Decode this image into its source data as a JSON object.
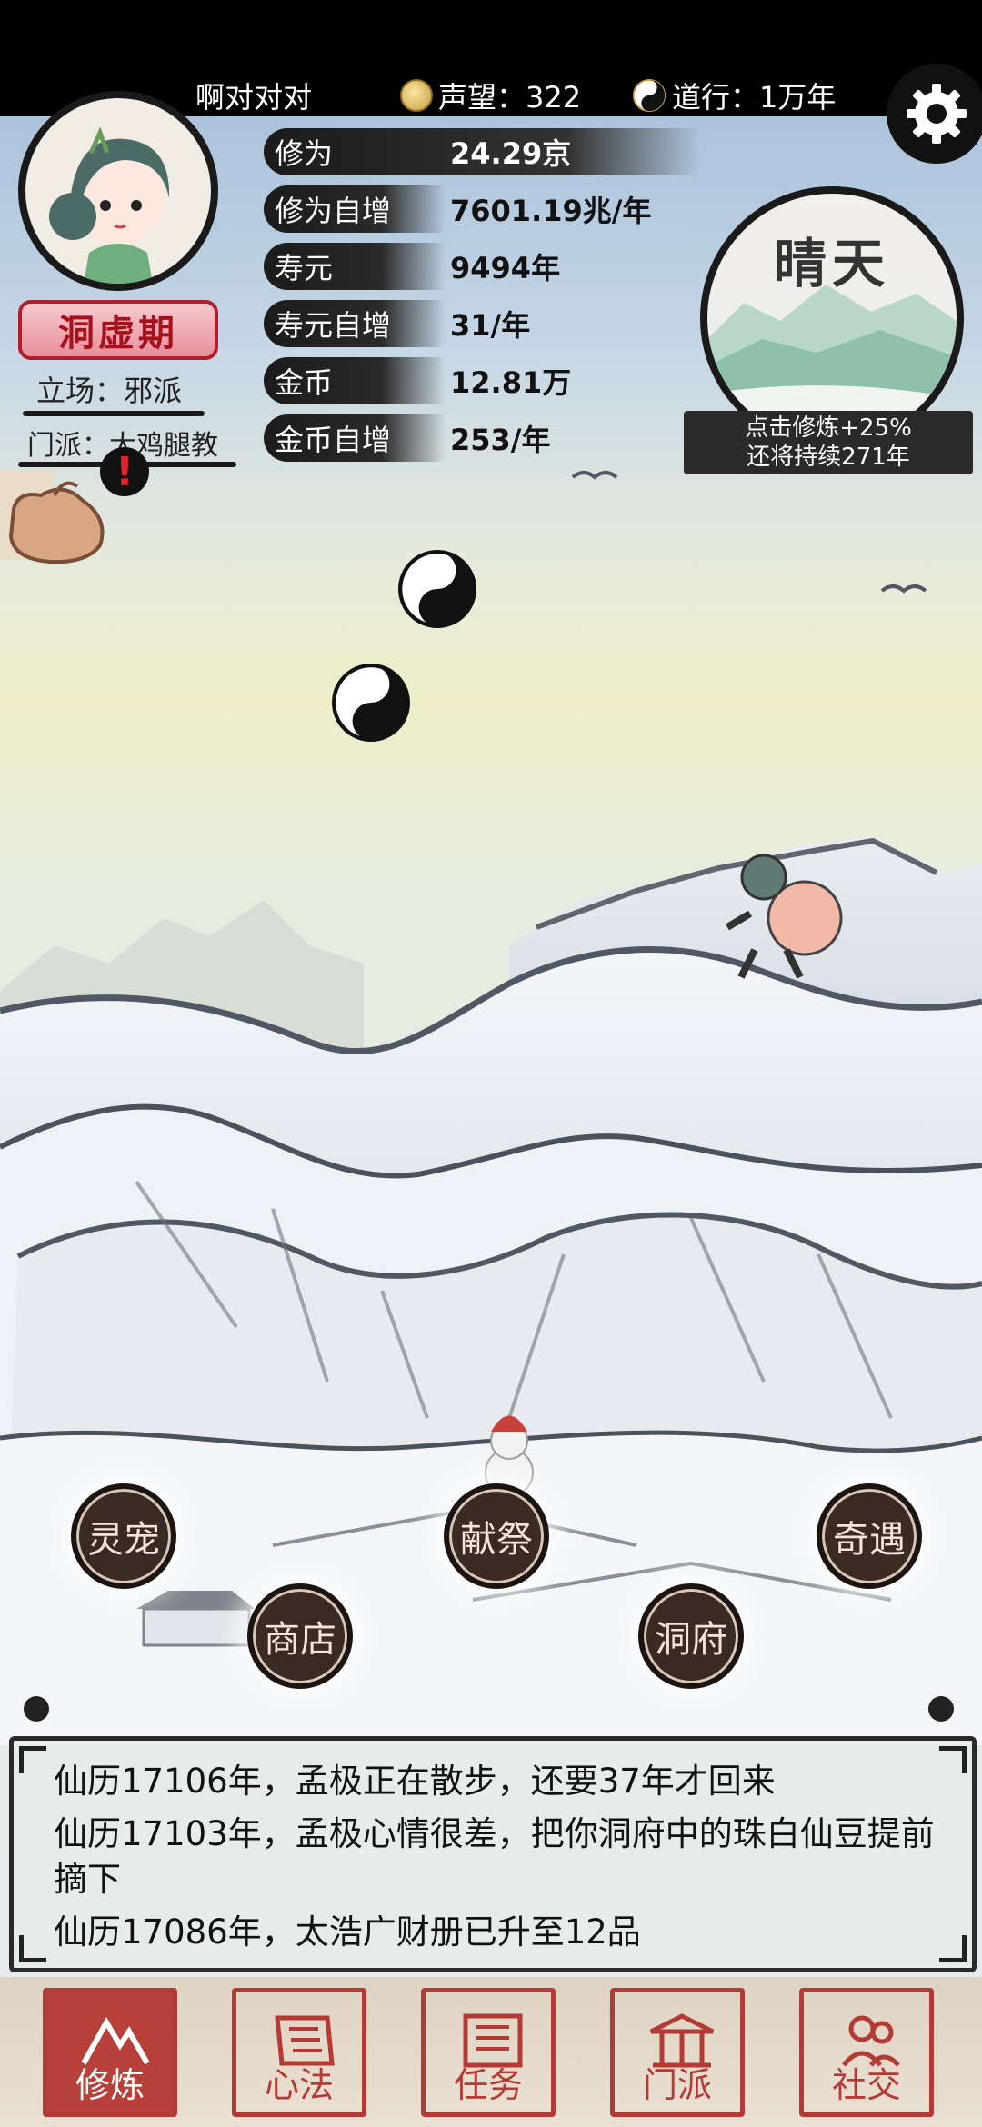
{
  "header": {
    "player_name": "啊对对对",
    "fame": "声望：322",
    "dao": "道行：1万年",
    "settings_icon": "gear-icon"
  },
  "profile": {
    "realm": "洞虚期",
    "stance": "立场：邪派",
    "sect": "门派：大鸡腿教",
    "bag_alert": "!"
  },
  "stats": [
    {
      "label": "修为",
      "value": "24.29京"
    },
    {
      "label": "修为自增",
      "value": "7601.19兆/年"
    },
    {
      "label": "寿元",
      "value": "9494年"
    },
    {
      "label": "寿元自增",
      "value": "31/年"
    },
    {
      "label": "金币",
      "value": "12.81万"
    },
    {
      "label": "金币自增",
      "value": "253/年"
    }
  ],
  "weather": {
    "title": "晴天",
    "tip_line1": "点击修炼+25%",
    "tip_line2": "还将持续271年"
  },
  "actions": {
    "pet": "灵宠",
    "sacrifice": "献祭",
    "encounter": "奇遇",
    "shop": "商店",
    "cave": "洞府"
  },
  "log": [
    "仙历17106年，孟极正在散步，还要37年才回来",
    "仙历17103年，孟极心情很差，把你洞府中的珠白仙豆提前摘下",
    "仙历17086年，太浩广财册已升至12品"
  ],
  "nav": [
    {
      "label": "修炼",
      "active": true
    },
    {
      "label": "心法",
      "active": false
    },
    {
      "label": "任务",
      "active": false
    },
    {
      "label": "门派",
      "active": false
    },
    {
      "label": "社交",
      "active": false
    }
  ],
  "colors": {
    "seal_red": "#b43a36",
    "realm_red": "#a4121f",
    "ink": "#1a1a1a"
  }
}
